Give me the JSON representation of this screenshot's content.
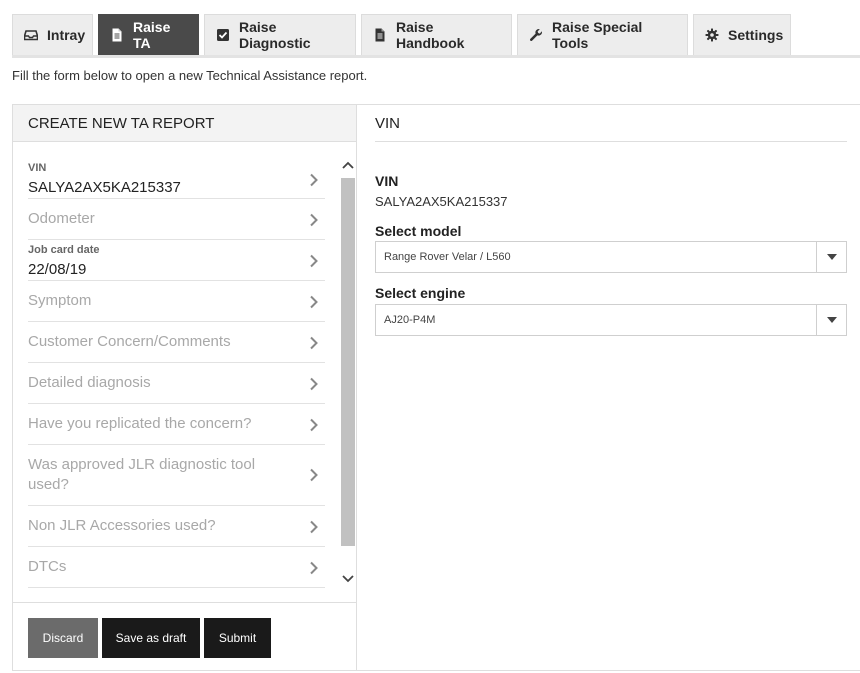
{
  "tabs": [
    {
      "label": "Intray",
      "icon": "inbox-icon"
    },
    {
      "label": "Raise TA",
      "icon": "document-icon",
      "active": true
    },
    {
      "label": "Raise Diagnostic",
      "icon": "checkbox-icon"
    },
    {
      "label": "Raise Handbook",
      "icon": "document-icon"
    },
    {
      "label": "Raise Special Tools",
      "icon": "wrench-icon"
    },
    {
      "label": "Settings",
      "icon": "gear-icon"
    }
  ],
  "intro_text": "Fill the form below to open a new Technical Assistance report.",
  "left_panel": {
    "title": "CREATE NEW TA REPORT",
    "items": [
      {
        "label": "VIN",
        "value": "SALYA2AX5KA215337"
      },
      {
        "placeholder": "Odometer"
      },
      {
        "label": "Job card date",
        "value": "22/08/19"
      },
      {
        "placeholder": "Symptom"
      },
      {
        "placeholder": "Customer Concern/Comments"
      },
      {
        "placeholder": "Detailed diagnosis"
      },
      {
        "placeholder": "Have you replicated the concern?"
      },
      {
        "placeholder": "Was approved JLR diagnostic tool used?"
      },
      {
        "placeholder": "Non JLR Accessories used?"
      },
      {
        "placeholder": "DTCs"
      }
    ],
    "buttons": {
      "discard": "Discard",
      "save_draft": "Save as draft",
      "submit": "Submit"
    }
  },
  "right_panel": {
    "title": "VIN",
    "vin_label": "VIN",
    "vin_value": "SALYA2AX5KA215337",
    "model_label": "Select model",
    "model_value": "Range Rover Velar / L560",
    "engine_label": "Select engine",
    "engine_value": "AJ20-P4M"
  }
}
